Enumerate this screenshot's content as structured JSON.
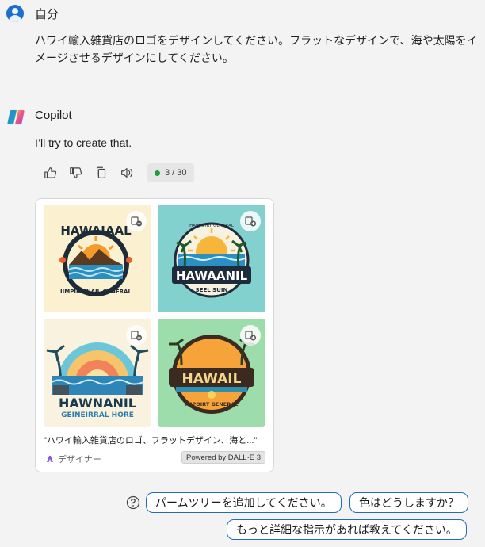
{
  "user": {
    "name": "自分",
    "message": "ハワイ輸入雑貨店のロゴをデザインしてください。フラットなデザインで、海や太陽をイメージさせるデザインにしてください。"
  },
  "copilot": {
    "name": "Copilot",
    "message": "I’ll try to create that.",
    "actions": [
      "thumbs-up-icon",
      "thumbs-down-icon",
      "copy-icon",
      "speaker-icon"
    ],
    "counter": "3 / 30",
    "counter_color": "#1f9d3a"
  },
  "image_card": {
    "images": [
      {
        "logo_top": "HAWAIAAL",
        "logo_bottom": "IIMPIRITNAIL GENERAL"
      },
      {
        "logo_top": "HAWAANIL",
        "logo_sub": "SEEL  SUIN",
        "logo_arc": "HAWAPIRT GENERAL"
      },
      {
        "logo_top": "HAWNANIL",
        "logo_bottom": "GEINEIRRAL HORE"
      },
      {
        "logo_top": "HAWAIL",
        "logo_bottom": "IMPOIRT GENERAL"
      }
    ],
    "caption": "\"ハワイ輸入雑貨店のロゴ、フラットデザイン、海と...\"",
    "designer_label": "デザイナー",
    "powered_by": "Powered by DALL·E 3"
  },
  "suggestions": [
    "パームツリーを追加してください。",
    "色はどうしますか？",
    "もっと詳細な指示があれば教えてください。"
  ],
  "colors": {
    "accent": "#1f6bc4",
    "background": "#f3f3f3"
  }
}
